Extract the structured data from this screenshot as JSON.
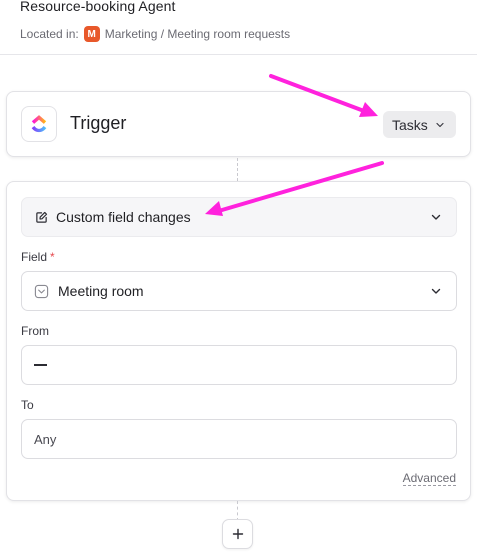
{
  "header": {
    "title": "Resource-booking Agent",
    "located_label": "Located in:",
    "location_badge": "M",
    "location_path": "Marketing / Meeting room requests"
  },
  "trigger": {
    "label": "Trigger",
    "source_button": "Tasks",
    "logo_icon": "clickup-logo-icon"
  },
  "config": {
    "event": "Custom field changes",
    "field_label": "Field",
    "field_required_mark": "*",
    "field_value": "Meeting room",
    "from_label": "From",
    "to_label": "To",
    "to_value": "Any",
    "advanced_link": "Advanced"
  },
  "add_step": {
    "icon": "plus-icon"
  },
  "colors": {
    "annotation_arrow": "#ff22dd",
    "location_badge": "#e8582a",
    "required": "#e5484d"
  }
}
